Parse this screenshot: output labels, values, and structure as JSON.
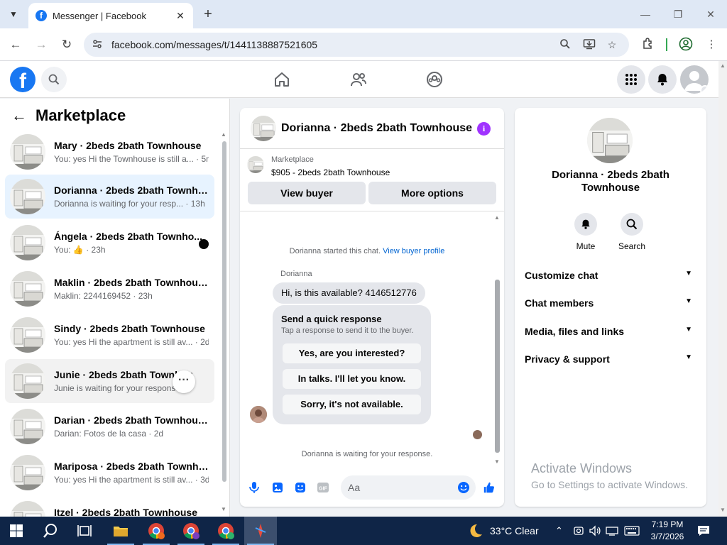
{
  "browser": {
    "tab_title": "Messenger | Facebook",
    "url": "facebook.com/messages/t/1441138887521605"
  },
  "sidebar": {
    "title": "Marketplace",
    "conversations": [
      {
        "name": "Mary · 2beds 2bath Townhouse",
        "snippet": "You: yes Hi the Townhouse is still a... · 5m"
      },
      {
        "name": "Dorianna · 2beds 2bath Townho...",
        "snippet": "Dorianna is waiting for your resp... · 13h"
      },
      {
        "name": "Ángela · 2beds 2bath Townho...",
        "snippet": "You: 👍 · 23h"
      },
      {
        "name": "Maklin · 2beds 2bath Townhouse",
        "snippet": "Maklin: 2244169452 · 23h"
      },
      {
        "name": "Sindy · 2beds 2bath Townhouse",
        "snippet": "You: yes Hi the apartment is still av... · 2d"
      },
      {
        "name": "Junie · 2beds 2bath Townhou",
        "snippet": "Junie is waiting for your response."
      },
      {
        "name": "Darian · 2beds 2bath Townhouse",
        "snippet": "Darian: Fotos de la casa · 2d"
      },
      {
        "name": "Mariposa · 2beds 2bath Townho...",
        "snippet": "You: yes Hi the apartment is still av... · 3d"
      },
      {
        "name": "Itzel · 2beds 2bath Townhouse",
        "snippet": ""
      }
    ]
  },
  "chat": {
    "title": "Dorianna · 2beds 2bath Townhouse",
    "marketplace_label": "Marketplace",
    "listing": "$905 - 2beds 2bath Townhouse",
    "view_buyer": "View buyer",
    "more_options": "More options",
    "started_text": "Dorianna started this chat.",
    "view_buyer_profile": "View buyer profile",
    "sender": "Dorianna",
    "message": "Hi, is this available? 4146512776",
    "quick_title": "Send a quick response",
    "quick_sub": "Tap a response to send it to the buyer.",
    "quick_options": [
      "Yes, are you interested?",
      "In talks. I'll let you know.",
      "Sorry, it's not available."
    ],
    "waiting": "Dorianna is waiting for your response.",
    "input_placeholder": "Aa"
  },
  "info": {
    "name": "Dorianna · 2beds 2bath Townhouse",
    "mute": "Mute",
    "search": "Search",
    "sections": [
      "Customize chat",
      "Chat members",
      "Media, files and links",
      "Privacy & support"
    ]
  },
  "watermark": {
    "line1": "Activate Windows",
    "line2": "Go to Settings to activate Windows."
  },
  "taskbar": {
    "weather": "33°C  Clear",
    "time": "7:19 PM",
    "date": "3/7/2026"
  },
  "colors": {
    "facebook_blue": "#1877f2",
    "active_conversation": "#e7f3ff",
    "info_purple": "#a033ff",
    "taskbar": "#0f2547"
  }
}
